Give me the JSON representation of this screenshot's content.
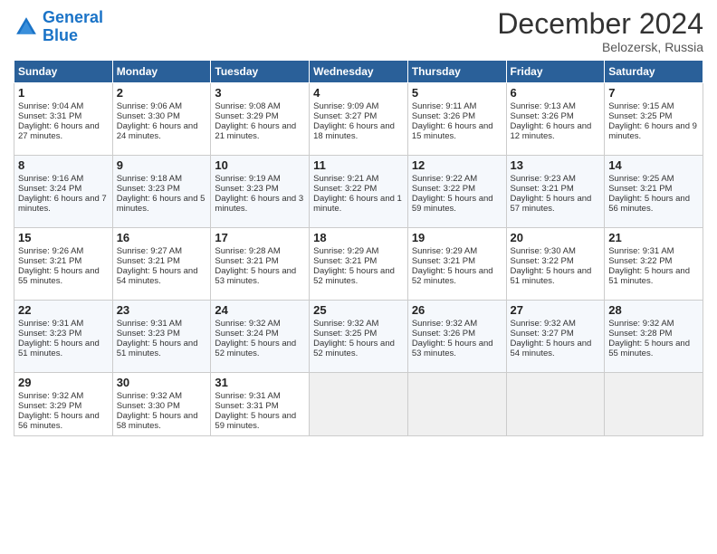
{
  "header": {
    "logo_line1": "General",
    "logo_line2": "Blue",
    "month": "December 2024",
    "location": "Belozersk, Russia"
  },
  "days_of_week": [
    "Sunday",
    "Monday",
    "Tuesday",
    "Wednesday",
    "Thursday",
    "Friday",
    "Saturday"
  ],
  "weeks": [
    [
      {
        "day": 1,
        "sunrise": "Sunrise: 9:04 AM",
        "sunset": "Sunset: 3:31 PM",
        "daylight": "Daylight: 6 hours and 27 minutes."
      },
      {
        "day": 2,
        "sunrise": "Sunrise: 9:06 AM",
        "sunset": "Sunset: 3:30 PM",
        "daylight": "Daylight: 6 hours and 24 minutes."
      },
      {
        "day": 3,
        "sunrise": "Sunrise: 9:08 AM",
        "sunset": "Sunset: 3:29 PM",
        "daylight": "Daylight: 6 hours and 21 minutes."
      },
      {
        "day": 4,
        "sunrise": "Sunrise: 9:09 AM",
        "sunset": "Sunset: 3:27 PM",
        "daylight": "Daylight: 6 hours and 18 minutes."
      },
      {
        "day": 5,
        "sunrise": "Sunrise: 9:11 AM",
        "sunset": "Sunset: 3:26 PM",
        "daylight": "Daylight: 6 hours and 15 minutes."
      },
      {
        "day": 6,
        "sunrise": "Sunrise: 9:13 AM",
        "sunset": "Sunset: 3:26 PM",
        "daylight": "Daylight: 6 hours and 12 minutes."
      },
      {
        "day": 7,
        "sunrise": "Sunrise: 9:15 AM",
        "sunset": "Sunset: 3:25 PM",
        "daylight": "Daylight: 6 hours and 9 minutes."
      }
    ],
    [
      {
        "day": 8,
        "sunrise": "Sunrise: 9:16 AM",
        "sunset": "Sunset: 3:24 PM",
        "daylight": "Daylight: 6 hours and 7 minutes."
      },
      {
        "day": 9,
        "sunrise": "Sunrise: 9:18 AM",
        "sunset": "Sunset: 3:23 PM",
        "daylight": "Daylight: 6 hours and 5 minutes."
      },
      {
        "day": 10,
        "sunrise": "Sunrise: 9:19 AM",
        "sunset": "Sunset: 3:23 PM",
        "daylight": "Daylight: 6 hours and 3 minutes."
      },
      {
        "day": 11,
        "sunrise": "Sunrise: 9:21 AM",
        "sunset": "Sunset: 3:22 PM",
        "daylight": "Daylight: 6 hours and 1 minute."
      },
      {
        "day": 12,
        "sunrise": "Sunrise: 9:22 AM",
        "sunset": "Sunset: 3:22 PM",
        "daylight": "Daylight: 5 hours and 59 minutes."
      },
      {
        "day": 13,
        "sunrise": "Sunrise: 9:23 AM",
        "sunset": "Sunset: 3:21 PM",
        "daylight": "Daylight: 5 hours and 57 minutes."
      },
      {
        "day": 14,
        "sunrise": "Sunrise: 9:25 AM",
        "sunset": "Sunset: 3:21 PM",
        "daylight": "Daylight: 5 hours and 56 minutes."
      }
    ],
    [
      {
        "day": 15,
        "sunrise": "Sunrise: 9:26 AM",
        "sunset": "Sunset: 3:21 PM",
        "daylight": "Daylight: 5 hours and 55 minutes."
      },
      {
        "day": 16,
        "sunrise": "Sunrise: 9:27 AM",
        "sunset": "Sunset: 3:21 PM",
        "daylight": "Daylight: 5 hours and 54 minutes."
      },
      {
        "day": 17,
        "sunrise": "Sunrise: 9:28 AM",
        "sunset": "Sunset: 3:21 PM",
        "daylight": "Daylight: 5 hours and 53 minutes."
      },
      {
        "day": 18,
        "sunrise": "Sunrise: 9:29 AM",
        "sunset": "Sunset: 3:21 PM",
        "daylight": "Daylight: 5 hours and 52 minutes."
      },
      {
        "day": 19,
        "sunrise": "Sunrise: 9:29 AM",
        "sunset": "Sunset: 3:21 PM",
        "daylight": "Daylight: 5 hours and 52 minutes."
      },
      {
        "day": 20,
        "sunrise": "Sunrise: 9:30 AM",
        "sunset": "Sunset: 3:22 PM",
        "daylight": "Daylight: 5 hours and 51 minutes."
      },
      {
        "day": 21,
        "sunrise": "Sunrise: 9:31 AM",
        "sunset": "Sunset: 3:22 PM",
        "daylight": "Daylight: 5 hours and 51 minutes."
      }
    ],
    [
      {
        "day": 22,
        "sunrise": "Sunrise: 9:31 AM",
        "sunset": "Sunset: 3:23 PM",
        "daylight": "Daylight: 5 hours and 51 minutes."
      },
      {
        "day": 23,
        "sunrise": "Sunrise: 9:31 AM",
        "sunset": "Sunset: 3:23 PM",
        "daylight": "Daylight: 5 hours and 51 minutes."
      },
      {
        "day": 24,
        "sunrise": "Sunrise: 9:32 AM",
        "sunset": "Sunset: 3:24 PM",
        "daylight": "Daylight: 5 hours and 52 minutes."
      },
      {
        "day": 25,
        "sunrise": "Sunrise: 9:32 AM",
        "sunset": "Sunset: 3:25 PM",
        "daylight": "Daylight: 5 hours and 52 minutes."
      },
      {
        "day": 26,
        "sunrise": "Sunrise: 9:32 AM",
        "sunset": "Sunset: 3:26 PM",
        "daylight": "Daylight: 5 hours and 53 minutes."
      },
      {
        "day": 27,
        "sunrise": "Sunrise: 9:32 AM",
        "sunset": "Sunset: 3:27 PM",
        "daylight": "Daylight: 5 hours and 54 minutes."
      },
      {
        "day": 28,
        "sunrise": "Sunrise: 9:32 AM",
        "sunset": "Sunset: 3:28 PM",
        "daylight": "Daylight: 5 hours and 55 minutes."
      }
    ],
    [
      {
        "day": 29,
        "sunrise": "Sunrise: 9:32 AM",
        "sunset": "Sunset: 3:29 PM",
        "daylight": "Daylight: 5 hours and 56 minutes."
      },
      {
        "day": 30,
        "sunrise": "Sunrise: 9:32 AM",
        "sunset": "Sunset: 3:30 PM",
        "daylight": "Daylight: 5 hours and 58 minutes."
      },
      {
        "day": 31,
        "sunrise": "Sunrise: 9:31 AM",
        "sunset": "Sunset: 3:31 PM",
        "daylight": "Daylight: 5 hours and 59 minutes."
      },
      null,
      null,
      null,
      null
    ]
  ]
}
